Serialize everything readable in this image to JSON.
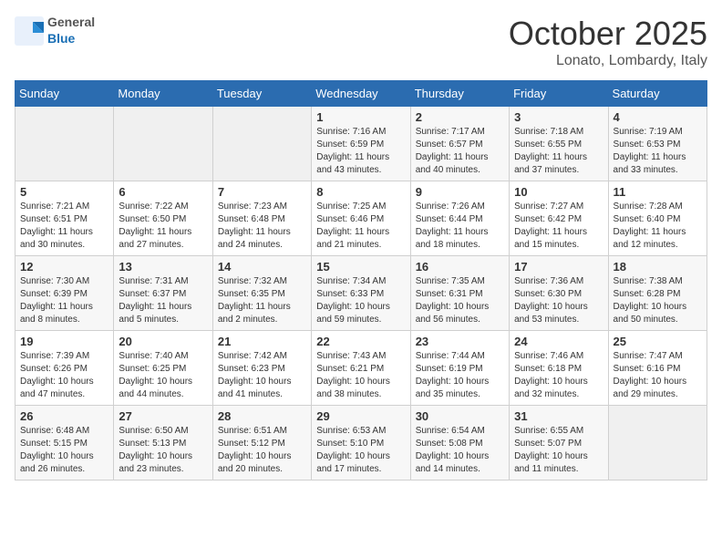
{
  "header": {
    "logo_general": "General",
    "logo_blue": "Blue",
    "month": "October 2025",
    "location": "Lonato, Lombardy, Italy"
  },
  "weekdays": [
    "Sunday",
    "Monday",
    "Tuesday",
    "Wednesday",
    "Thursday",
    "Friday",
    "Saturday"
  ],
  "weeks": [
    [
      {
        "day": "",
        "sunrise": "",
        "sunset": "",
        "daylight": ""
      },
      {
        "day": "",
        "sunrise": "",
        "sunset": "",
        "daylight": ""
      },
      {
        "day": "",
        "sunrise": "",
        "sunset": "",
        "daylight": ""
      },
      {
        "day": "1",
        "sunrise": "Sunrise: 7:16 AM",
        "sunset": "Sunset: 6:59 PM",
        "daylight": "Daylight: 11 hours and 43 minutes."
      },
      {
        "day": "2",
        "sunrise": "Sunrise: 7:17 AM",
        "sunset": "Sunset: 6:57 PM",
        "daylight": "Daylight: 11 hours and 40 minutes."
      },
      {
        "day": "3",
        "sunrise": "Sunrise: 7:18 AM",
        "sunset": "Sunset: 6:55 PM",
        "daylight": "Daylight: 11 hours and 37 minutes."
      },
      {
        "day": "4",
        "sunrise": "Sunrise: 7:19 AM",
        "sunset": "Sunset: 6:53 PM",
        "daylight": "Daylight: 11 hours and 33 minutes."
      }
    ],
    [
      {
        "day": "5",
        "sunrise": "Sunrise: 7:21 AM",
        "sunset": "Sunset: 6:51 PM",
        "daylight": "Daylight: 11 hours and 30 minutes."
      },
      {
        "day": "6",
        "sunrise": "Sunrise: 7:22 AM",
        "sunset": "Sunset: 6:50 PM",
        "daylight": "Daylight: 11 hours and 27 minutes."
      },
      {
        "day": "7",
        "sunrise": "Sunrise: 7:23 AM",
        "sunset": "Sunset: 6:48 PM",
        "daylight": "Daylight: 11 hours and 24 minutes."
      },
      {
        "day": "8",
        "sunrise": "Sunrise: 7:25 AM",
        "sunset": "Sunset: 6:46 PM",
        "daylight": "Daylight: 11 hours and 21 minutes."
      },
      {
        "day": "9",
        "sunrise": "Sunrise: 7:26 AM",
        "sunset": "Sunset: 6:44 PM",
        "daylight": "Daylight: 11 hours and 18 minutes."
      },
      {
        "day": "10",
        "sunrise": "Sunrise: 7:27 AM",
        "sunset": "Sunset: 6:42 PM",
        "daylight": "Daylight: 11 hours and 15 minutes."
      },
      {
        "day": "11",
        "sunrise": "Sunrise: 7:28 AM",
        "sunset": "Sunset: 6:40 PM",
        "daylight": "Daylight: 11 hours and 12 minutes."
      }
    ],
    [
      {
        "day": "12",
        "sunrise": "Sunrise: 7:30 AM",
        "sunset": "Sunset: 6:39 PM",
        "daylight": "Daylight: 11 hours and 8 minutes."
      },
      {
        "day": "13",
        "sunrise": "Sunrise: 7:31 AM",
        "sunset": "Sunset: 6:37 PM",
        "daylight": "Daylight: 11 hours and 5 minutes."
      },
      {
        "day": "14",
        "sunrise": "Sunrise: 7:32 AM",
        "sunset": "Sunset: 6:35 PM",
        "daylight": "Daylight: 11 hours and 2 minutes."
      },
      {
        "day": "15",
        "sunrise": "Sunrise: 7:34 AM",
        "sunset": "Sunset: 6:33 PM",
        "daylight": "Daylight: 10 hours and 59 minutes."
      },
      {
        "day": "16",
        "sunrise": "Sunrise: 7:35 AM",
        "sunset": "Sunset: 6:31 PM",
        "daylight": "Daylight: 10 hours and 56 minutes."
      },
      {
        "day": "17",
        "sunrise": "Sunrise: 7:36 AM",
        "sunset": "Sunset: 6:30 PM",
        "daylight": "Daylight: 10 hours and 53 minutes."
      },
      {
        "day": "18",
        "sunrise": "Sunrise: 7:38 AM",
        "sunset": "Sunset: 6:28 PM",
        "daylight": "Daylight: 10 hours and 50 minutes."
      }
    ],
    [
      {
        "day": "19",
        "sunrise": "Sunrise: 7:39 AM",
        "sunset": "Sunset: 6:26 PM",
        "daylight": "Daylight: 10 hours and 47 minutes."
      },
      {
        "day": "20",
        "sunrise": "Sunrise: 7:40 AM",
        "sunset": "Sunset: 6:25 PM",
        "daylight": "Daylight: 10 hours and 44 minutes."
      },
      {
        "day": "21",
        "sunrise": "Sunrise: 7:42 AM",
        "sunset": "Sunset: 6:23 PM",
        "daylight": "Daylight: 10 hours and 41 minutes."
      },
      {
        "day": "22",
        "sunrise": "Sunrise: 7:43 AM",
        "sunset": "Sunset: 6:21 PM",
        "daylight": "Daylight: 10 hours and 38 minutes."
      },
      {
        "day": "23",
        "sunrise": "Sunrise: 7:44 AM",
        "sunset": "Sunset: 6:19 PM",
        "daylight": "Daylight: 10 hours and 35 minutes."
      },
      {
        "day": "24",
        "sunrise": "Sunrise: 7:46 AM",
        "sunset": "Sunset: 6:18 PM",
        "daylight": "Daylight: 10 hours and 32 minutes."
      },
      {
        "day": "25",
        "sunrise": "Sunrise: 7:47 AM",
        "sunset": "Sunset: 6:16 PM",
        "daylight": "Daylight: 10 hours and 29 minutes."
      }
    ],
    [
      {
        "day": "26",
        "sunrise": "Sunrise: 6:48 AM",
        "sunset": "Sunset: 5:15 PM",
        "daylight": "Daylight: 10 hours and 26 minutes."
      },
      {
        "day": "27",
        "sunrise": "Sunrise: 6:50 AM",
        "sunset": "Sunset: 5:13 PM",
        "daylight": "Daylight: 10 hours and 23 minutes."
      },
      {
        "day": "28",
        "sunrise": "Sunrise: 6:51 AM",
        "sunset": "Sunset: 5:12 PM",
        "daylight": "Daylight: 10 hours and 20 minutes."
      },
      {
        "day": "29",
        "sunrise": "Sunrise: 6:53 AM",
        "sunset": "Sunset: 5:10 PM",
        "daylight": "Daylight: 10 hours and 17 minutes."
      },
      {
        "day": "30",
        "sunrise": "Sunrise: 6:54 AM",
        "sunset": "Sunset: 5:08 PM",
        "daylight": "Daylight: 10 hours and 14 minutes."
      },
      {
        "day": "31",
        "sunrise": "Sunrise: 6:55 AM",
        "sunset": "Sunset: 5:07 PM",
        "daylight": "Daylight: 10 hours and 11 minutes."
      },
      {
        "day": "",
        "sunrise": "",
        "sunset": "",
        "daylight": ""
      }
    ]
  ]
}
